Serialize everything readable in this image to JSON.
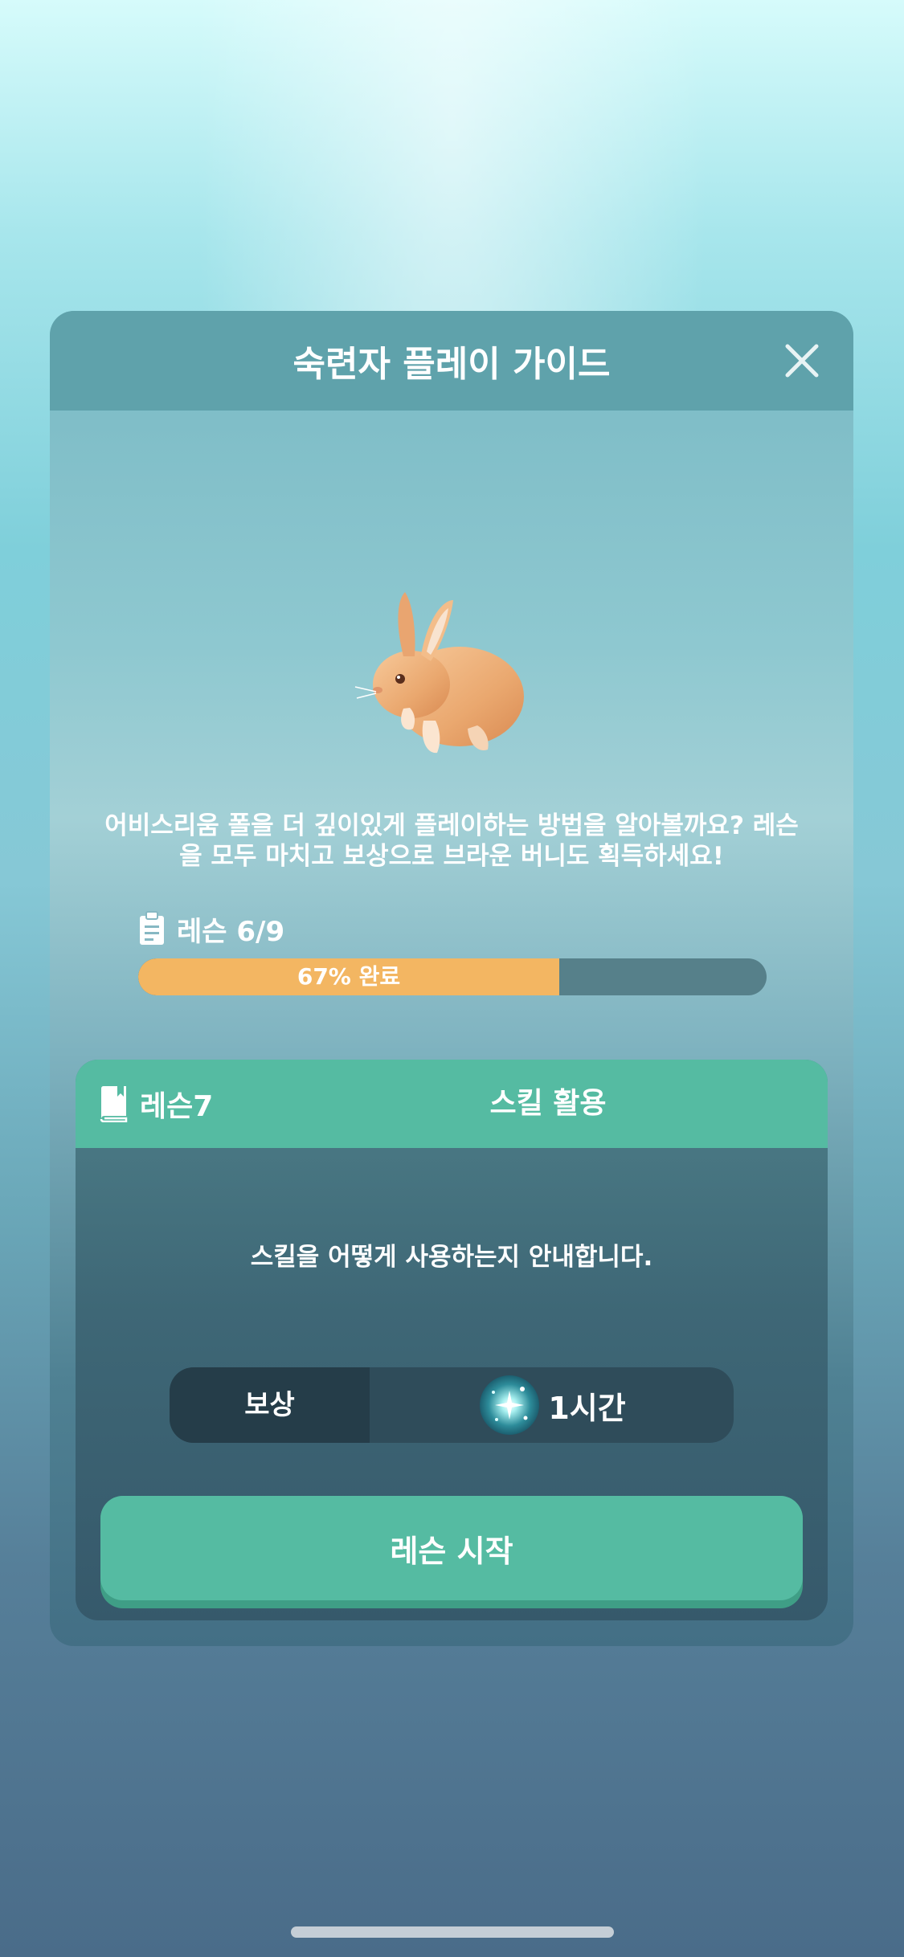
{
  "modal": {
    "title": "숙련자 플레이 가이드",
    "description": "어비스리움 폴을 더 깊이있게 플레이하는 방법을 알아볼까요? 레슨을 모두 마치고 보상으로 브라운 버니도 획득하세요!",
    "lesson_progress_label": "레슨 6/9",
    "progress": {
      "fraction": 0.67,
      "label": "67% 완료",
      "fill_color": "#f3b662",
      "track_color": "#56808a"
    }
  },
  "lesson_card": {
    "lesson_label": "레슨7",
    "title": "스킬 활용",
    "description": "스킬을 어떻게 사용하는지 안내합니다.",
    "reward_label": "보상",
    "reward_value": "1시간",
    "start_button": "레슨 시작",
    "accent_color": "#55bba2"
  },
  "icons": {
    "close": "close-icon",
    "clipboard": "clipboard-icon",
    "book": "book-icon",
    "reward_orb": "sparkle-orb-icon"
  }
}
